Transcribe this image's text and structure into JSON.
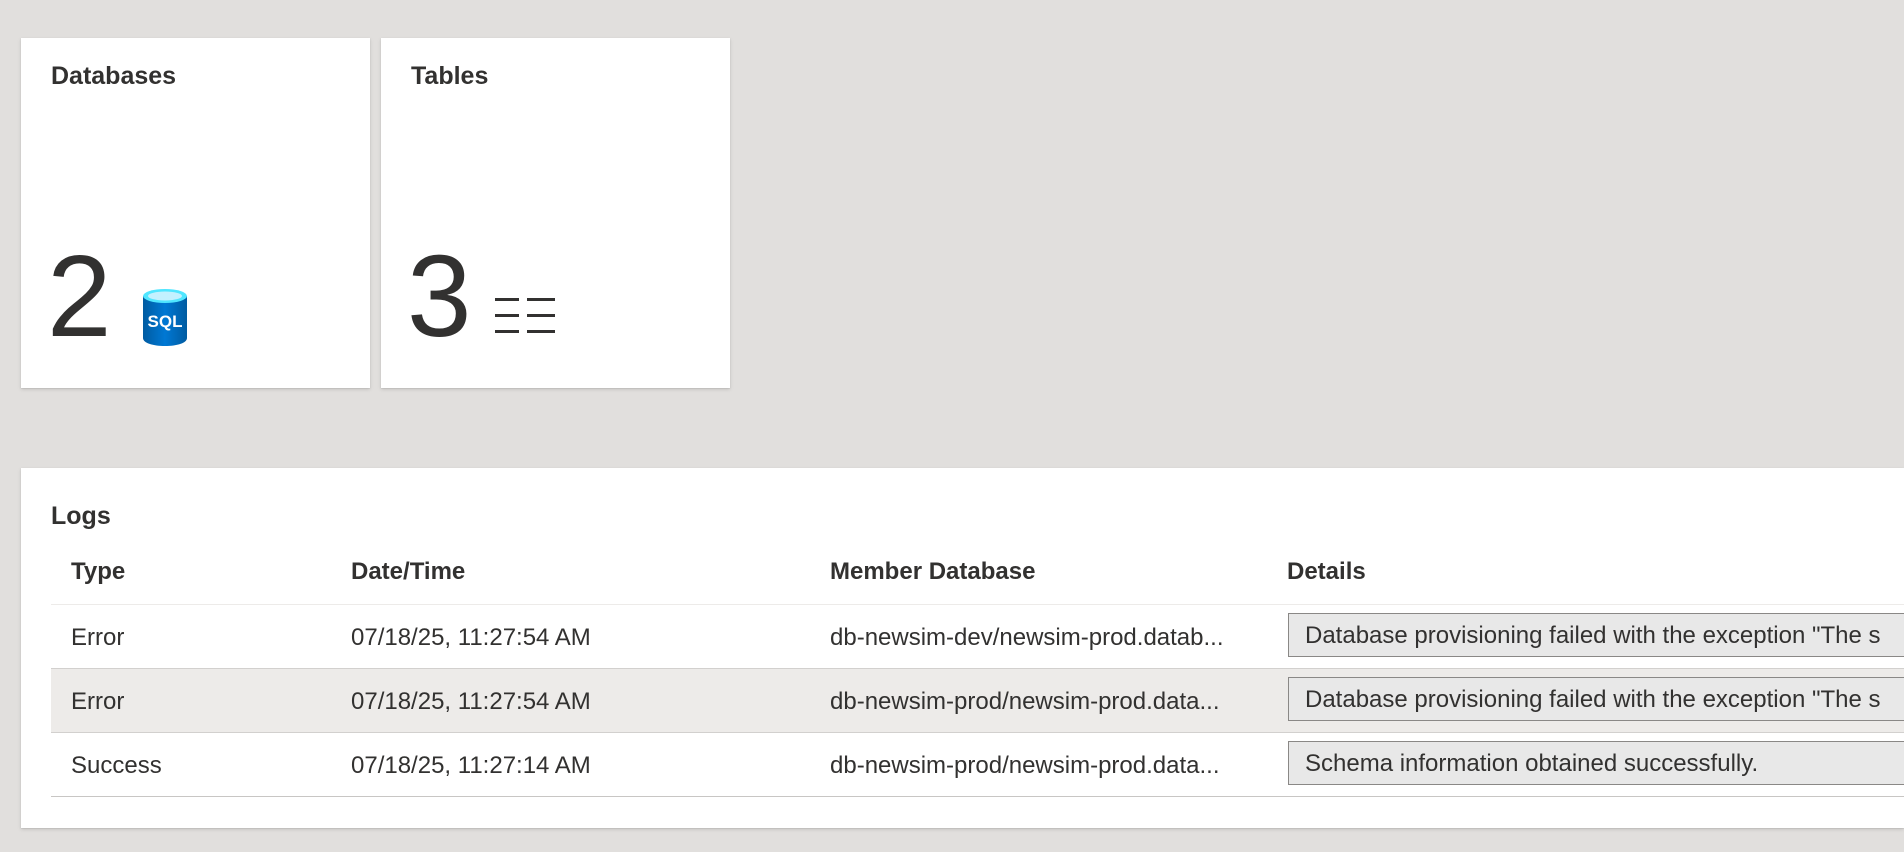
{
  "tiles": [
    {
      "title": "Databases",
      "value": "2",
      "icon": "sql-database-icon",
      "icon_text": "SQL"
    },
    {
      "title": "Tables",
      "value": "3",
      "icon": "table-icon"
    }
  ],
  "logs": {
    "title": "Logs",
    "columns": [
      "Type",
      "Date/Time",
      "Member Database",
      "Details"
    ],
    "rows": [
      {
        "type": "Error",
        "datetime": "07/18/25, 11:27:54 AM",
        "member_database": "db-newsim-dev/newsim-prod.datab...",
        "details": "Database provisioning failed with the exception \"The s"
      },
      {
        "type": "Error",
        "datetime": "07/18/25, 11:27:54 AM",
        "member_database": "db-newsim-prod/newsim-prod.data...",
        "details": "Database provisioning failed with the exception \"The s"
      },
      {
        "type": "Success",
        "datetime": "07/18/25, 11:27:14 AM",
        "member_database": "db-newsim-prod/newsim-prod.data...",
        "details": "Schema information obtained successfully."
      }
    ]
  },
  "colors": {
    "background": "#e1dfdd",
    "tile": "#ffffff",
    "sql_icon_blue": "#0078d4",
    "text": "#323130"
  }
}
